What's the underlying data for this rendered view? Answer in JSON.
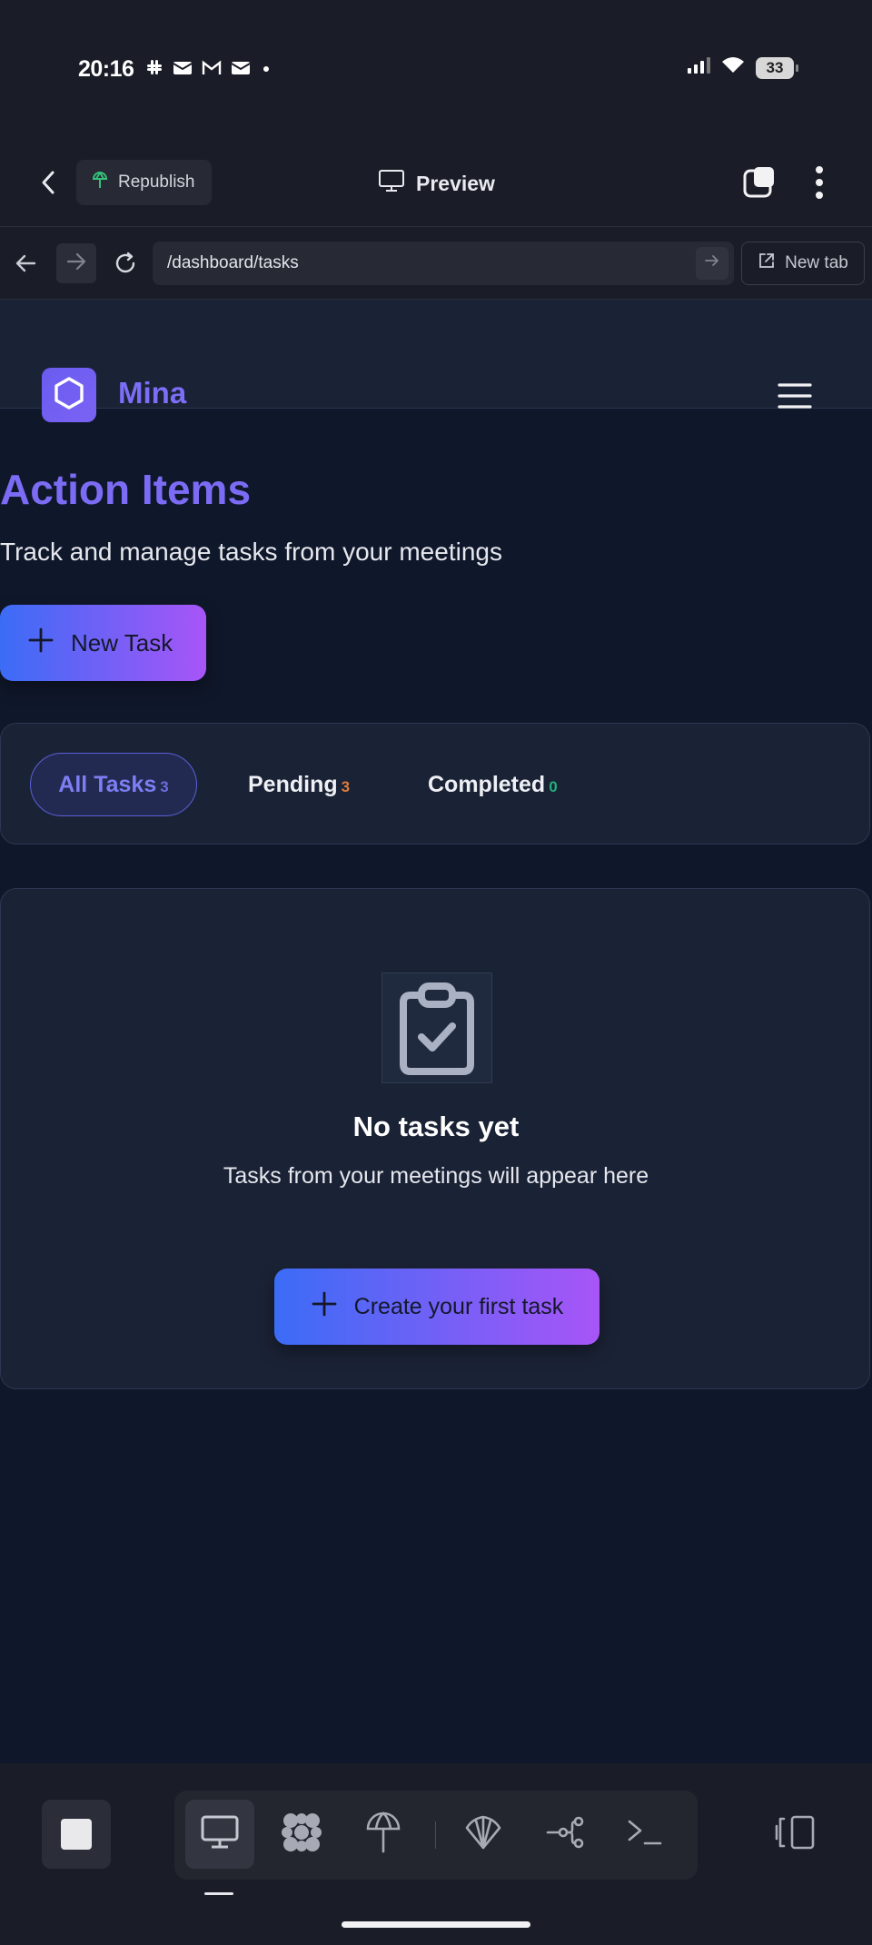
{
  "status_bar": {
    "time": "20:16",
    "battery": "33"
  },
  "app_toolbar": {
    "republish_label": "Republish",
    "preview_label": "Preview"
  },
  "browser": {
    "url": "/dashboard/tasks",
    "new_tab_label": "New tab"
  },
  "site": {
    "brand": "Mina"
  },
  "page": {
    "title": "Action Items",
    "subtitle": "Track and manage tasks from your meetings",
    "new_task_label": "New Task"
  },
  "filters": [
    {
      "label": "All Tasks",
      "count": "3"
    },
    {
      "label": "Pending",
      "count": "3"
    },
    {
      "label": "Completed",
      "count": "0"
    }
  ],
  "empty_state": {
    "title": "No tasks yet",
    "description": "Tasks from your meetings will appear here",
    "cta_label": "Create your first task"
  },
  "colors": {
    "accent": "#7c6ef6",
    "gradient_start": "#3b6cf6",
    "gradient_end": "#a855f7",
    "page_bg": "#0f172a",
    "card_bg": "#1a2235"
  }
}
